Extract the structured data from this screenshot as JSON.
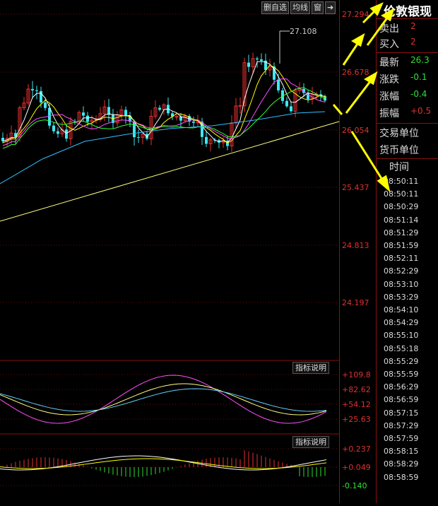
{
  "toolbar": {
    "del_self_select": "删自选",
    "ma_lines": "均线",
    "window": "窗",
    "arrow": "➔"
  },
  "price_axis": {
    "labels": [
      "27.294",
      "26.678",
      "26.054",
      "25.437",
      "24.813",
      "24.197"
    ]
  },
  "peak_label": "27.108",
  "indicator_btn": "指标说明",
  "kdj_axis": {
    "labels": [
      "+109.8",
      "+82.62",
      "+54.12",
      "+25.63"
    ]
  },
  "macd_axis": {
    "labels": [
      "+0.237",
      "+0.049",
      "-0.140"
    ]
  },
  "panel": {
    "title": "伦敦银现",
    "rows": [
      {
        "label": "卖出",
        "value": "2"
      },
      {
        "label": "买入",
        "value": "2"
      },
      {
        "label": "最新",
        "value": "26.3"
      },
      {
        "label": "涨跌",
        "value": "-0.1"
      },
      {
        "label": "涨幅",
        "value": "-0.4"
      },
      {
        "label": "振幅",
        "value": "+0.5"
      }
    ],
    "trade_unit": "交易单位",
    "currency_unit": "货币单位",
    "time_header": "时间",
    "times": [
      "08:50:11",
      "08:50:11",
      "08:50:29",
      "08:51:14",
      "08:51:29",
      "08:51:59",
      "08:52:11",
      "08:52:29",
      "08:53:10",
      "08:53:29",
      "08:54:10",
      "08:54:29",
      "08:55:10",
      "08:55:18",
      "08:55:29",
      "08:55:59",
      "08:56:29",
      "08:56:59",
      "08:57:15",
      "08:57:29",
      "08:57:59",
      "08:58:15",
      "08:58:29",
      "08:58:59"
    ]
  },
  "colors": {
    "up": "#e83030",
    "down": "#3ee8f0",
    "trend": "#ffff80",
    "ma1": "#ffffff",
    "ma2": "#ffff00",
    "ma3": "#ff50ff",
    "ma4": "#30ff30",
    "ma5": "#30c0ff",
    "arrow": "#ffff00"
  }
}
